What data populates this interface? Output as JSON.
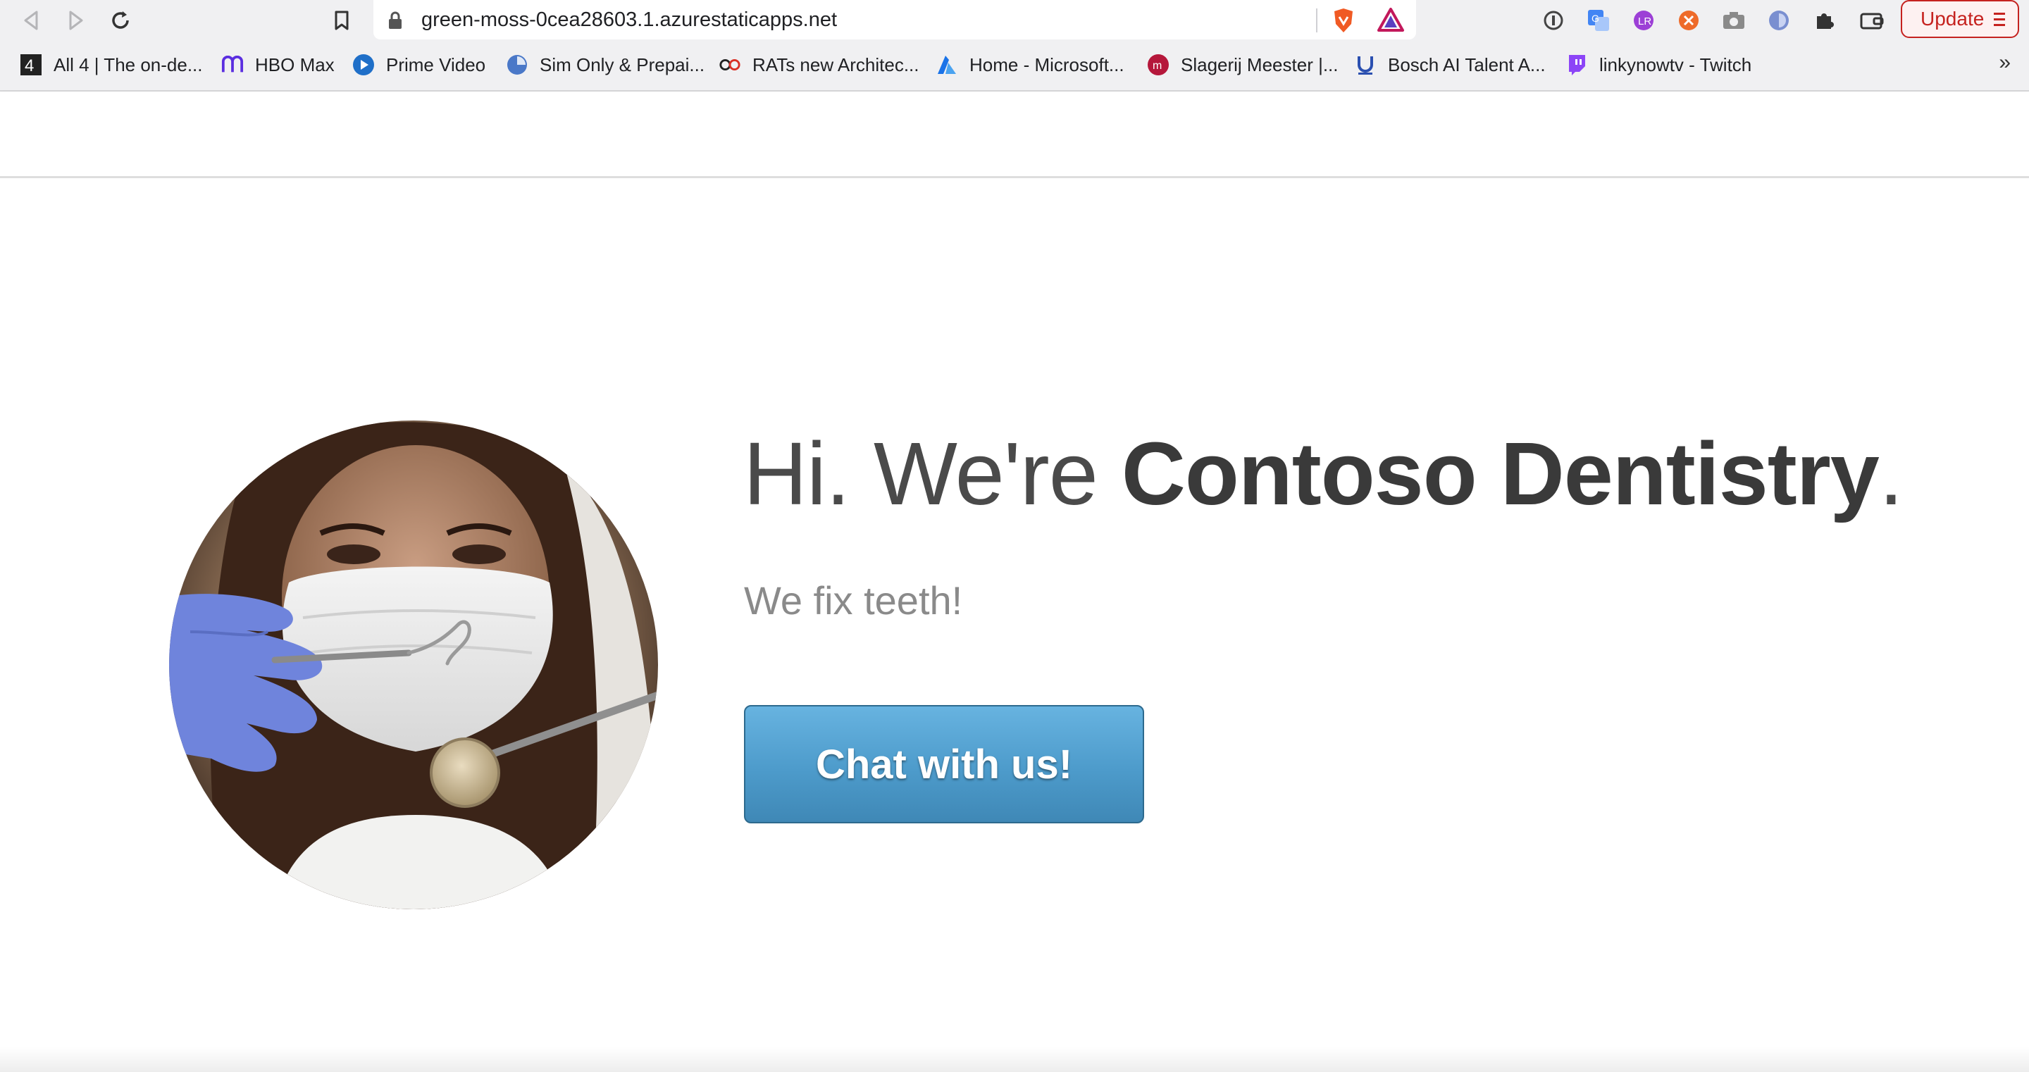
{
  "browser": {
    "url": "green-moss-0cea28603.1.azurestaticapps.net",
    "update_label": "Update",
    "bookmarks": [
      {
        "label": "All 4 | The on-de..."
      },
      {
        "label": "HBO Max"
      },
      {
        "label": "Prime Video"
      },
      {
        "label": "Sim Only & Prepai..."
      },
      {
        "label": "RATs new Architec..."
      },
      {
        "label": "Home - Microsoft..."
      },
      {
        "label": "Slagerij Meester |..."
      },
      {
        "label": "Bosch AI Talent A..."
      },
      {
        "label": "linkynowtv - Twitch"
      }
    ],
    "more_label": "»"
  },
  "hero": {
    "greeting": "Hi. We're ",
    "brand": "Contoso Dentistry",
    "period": ".",
    "tagline": "We fix teeth!",
    "cta_label": "Chat with us!"
  },
  "colors": {
    "cta": "#4d9bcb",
    "update": "#c5221f"
  }
}
